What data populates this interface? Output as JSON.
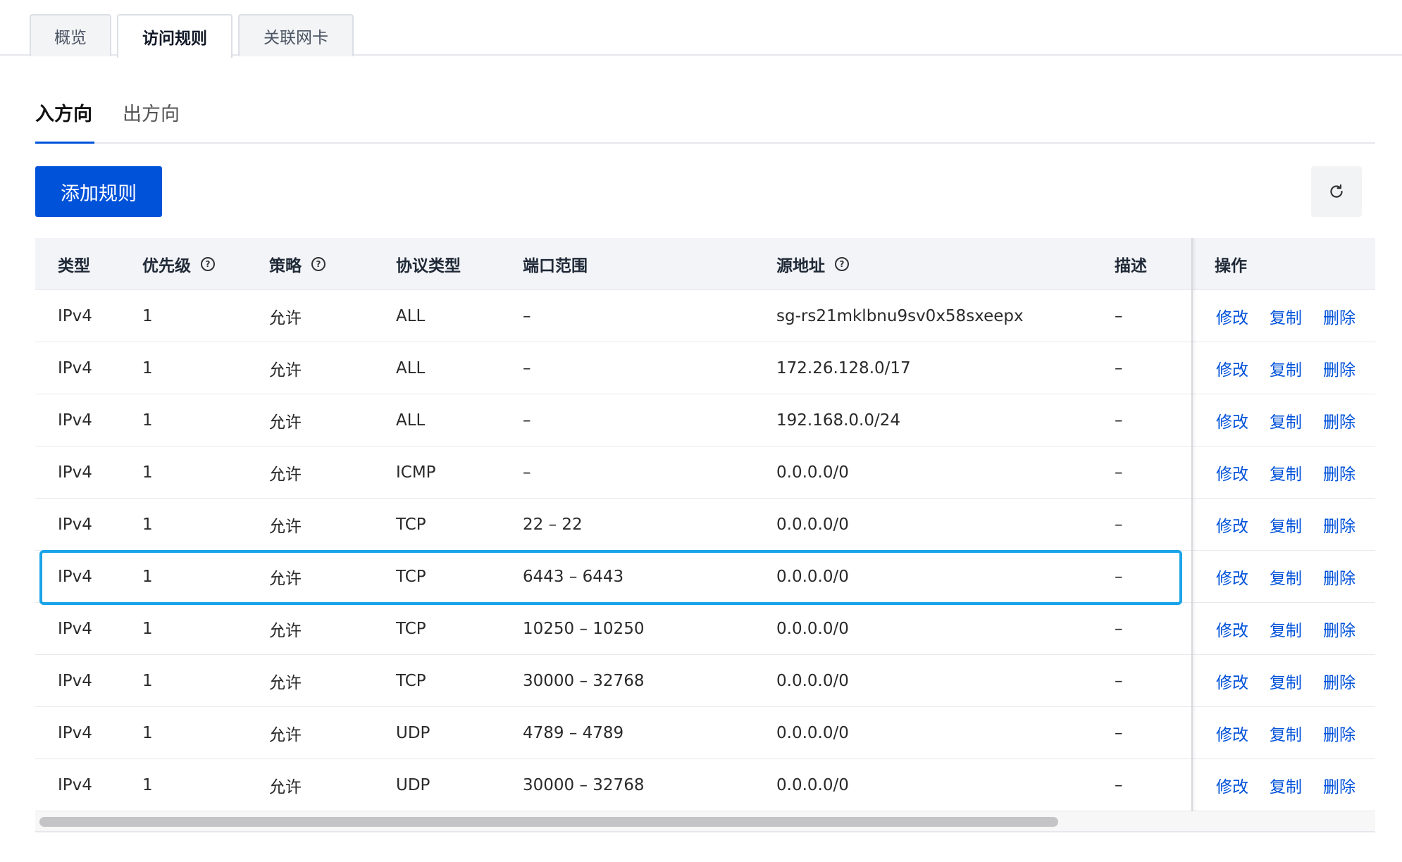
{
  "top_tabs": [
    {
      "label": "概览",
      "active": false
    },
    {
      "label": "访问规则",
      "active": true
    },
    {
      "label": "关联网卡",
      "active": false
    }
  ],
  "direction_tabs": [
    {
      "label": "入方向",
      "active": true
    },
    {
      "label": "出方向",
      "active": false
    }
  ],
  "toolbar": {
    "add_rule_label": "添加规则",
    "refresh_icon": "refresh-icon"
  },
  "table": {
    "columns": [
      "类型",
      "优先级",
      "策略",
      "协议类型",
      "端口范围",
      "源地址",
      "描述",
      "操作"
    ],
    "help_icon": "?",
    "actions": [
      "修改",
      "复制",
      "删除"
    ],
    "rows": [
      {
        "type": "IPv4",
        "priority": "1",
        "policy": "允许",
        "protocol": "ALL",
        "ports": "–",
        "source": "sg-rs21mklbnu9sv0x58sxeepx",
        "desc": "–"
      },
      {
        "type": "IPv4",
        "priority": "1",
        "policy": "允许",
        "protocol": "ALL",
        "ports": "–",
        "source": "172.26.128.0/17",
        "desc": "–"
      },
      {
        "type": "IPv4",
        "priority": "1",
        "policy": "允许",
        "protocol": "ALL",
        "ports": "–",
        "source": "192.168.0.0/24",
        "desc": "–"
      },
      {
        "type": "IPv4",
        "priority": "1",
        "policy": "允许",
        "protocol": "ICMP",
        "ports": "–",
        "source": "0.0.0.0/0",
        "desc": "–"
      },
      {
        "type": "IPv4",
        "priority": "1",
        "policy": "允许",
        "protocol": "TCP",
        "ports": "22 – 22",
        "source": "0.0.0.0/0",
        "desc": "–"
      },
      {
        "type": "IPv4",
        "priority": "1",
        "policy": "允许",
        "protocol": "TCP",
        "ports": "6443 – 6443",
        "source": "0.0.0.0/0",
        "desc": "–"
      },
      {
        "type": "IPv4",
        "priority": "1",
        "policy": "允许",
        "protocol": "TCP",
        "ports": "10250 – 10250",
        "source": "0.0.0.0/0",
        "desc": "–"
      },
      {
        "type": "IPv4",
        "priority": "1",
        "policy": "允许",
        "protocol": "TCP",
        "ports": "30000 – 32768",
        "source": "0.0.0.0/0",
        "desc": "–"
      },
      {
        "type": "IPv4",
        "priority": "1",
        "policy": "允许",
        "protocol": "UDP",
        "ports": "4789 – 4789",
        "source": "0.0.0.0/0",
        "desc": "–"
      },
      {
        "type": "IPv4",
        "priority": "1",
        "policy": "允许",
        "protocol": "UDP",
        "ports": "30000 – 32768",
        "source": "0.0.0.0/0",
        "desc": "–"
      }
    ]
  },
  "highlighted_row_index": 5,
  "colors": {
    "primary": "#0052d9",
    "highlight": "#1aa3e8"
  }
}
